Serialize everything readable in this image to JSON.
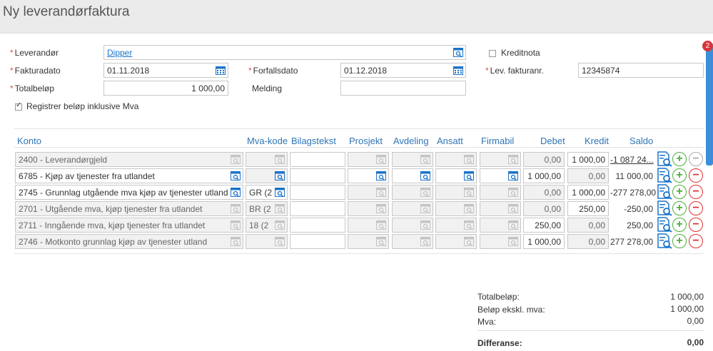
{
  "page": {
    "title": "Ny leverandørfaktura"
  },
  "form": {
    "leverandor_label": "Leverandør",
    "leverandor_value": "Dipper",
    "kreditnota_label": "Kreditnota",
    "fakturadato_label": "Fakturadato",
    "fakturadato_value": "01.11.2018",
    "forfallsdato_label": "Forfallsdato",
    "forfallsdato_value": "01.12.2018",
    "levfakturanr_label": "Lev. fakturanr.",
    "levfakturanr_value": "12345874",
    "totalbelop_label": "Totalbeløp",
    "totalbelop_value": "1 000,00",
    "melding_label": "Melding",
    "melding_value": "",
    "inkl_mva_label": "Registrer beløp inklusive Mva",
    "inkl_mva_checked": true,
    "kreditnota_checked": false
  },
  "notification_count": "2",
  "table": {
    "headers": {
      "konto": "Konto",
      "mvakode": "Mva-kode",
      "bilagstekst": "Bilagstekst",
      "prosjekt": "Prosjekt",
      "avdeling": "Avdeling",
      "ansatt": "Ansatt",
      "firmabil": "Firmabil",
      "debet": "Debet",
      "kredit": "Kredit",
      "saldo": "Saldo"
    },
    "rows": [
      {
        "konto": "2400 - Leverandørgjeld",
        "mva": "",
        "debet": "0,00",
        "kredit": "1 000,00",
        "saldo": "-1 087 24...",
        "editable": false
      },
      {
        "konto": "6785 - Kjøp av tjenester fra utlandet",
        "mva": "",
        "debet": "1 000,00",
        "kredit": "0,00",
        "saldo": "11 000,00",
        "editable": true
      },
      {
        "konto": "2745 - Grunnlag utgående mva kjøp av tjenester utland",
        "mva": "GR (2",
        "debet": "0,00",
        "kredit": "1 000,00",
        "saldo": "-277 278,00",
        "editable": true
      },
      {
        "konto": "2701 - Utgående mva, kjøp tjenester fra utlandet",
        "mva": "BR (2",
        "debet": "0,00",
        "kredit": "250,00",
        "saldo": "-250,00",
        "editable": false
      },
      {
        "konto": "2711 - Inngående mva, kjøp tjenester fra utlandet",
        "mva": "18 (2",
        "debet": "250,00",
        "kredit": "0,00",
        "saldo": "250,00",
        "editable": false
      },
      {
        "konto": "2746 - Motkonto grunnlag kjøp av tjenester utland",
        "mva": "",
        "debet": "1 000,00",
        "kredit": "0,00",
        "saldo": "277 278,00",
        "editable": false
      }
    ]
  },
  "summary": {
    "totalbelop_label": "Totalbeløp:",
    "totalbelop_value": "1 000,00",
    "eksklmva_label": "Beløp ekskl. mva:",
    "eksklmva_value": "1 000,00",
    "mva_label": "Mva:",
    "mva_value": "0,00",
    "differanse_label": "Differanse:",
    "differanse_value": "0,00"
  },
  "colors": {
    "accent": "#2e75b6",
    "required": "#d9534f",
    "add": "#4caf3a",
    "remove": "#dd3333"
  }
}
